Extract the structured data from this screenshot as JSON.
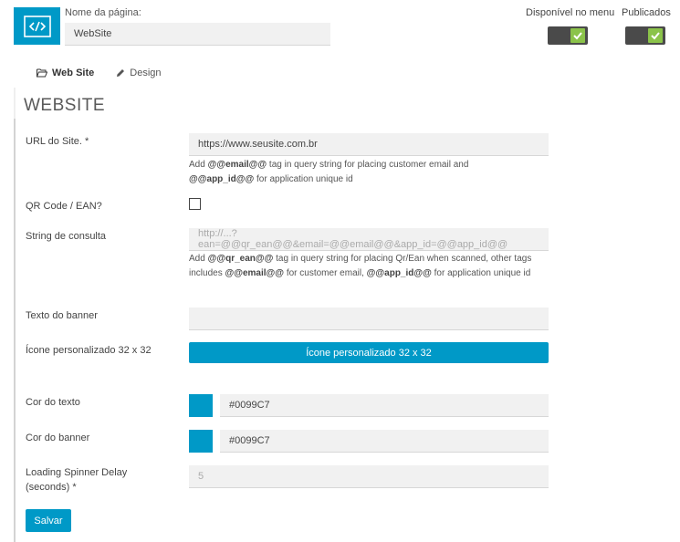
{
  "header": {
    "icon": "code-icon",
    "page_name_label": "Nome da página:",
    "page_name_value": "WebSite",
    "toggles": [
      {
        "label": "Disponível no menu",
        "checked": true
      },
      {
        "label": "Publicados",
        "checked": true
      }
    ]
  },
  "tabs": [
    {
      "label": "Web Site",
      "icon": "folder-open-icon",
      "active": true
    },
    {
      "label": "Design",
      "icon": "pencil-icon",
      "active": false
    }
  ],
  "panel": {
    "title": "WEBSITE",
    "url": {
      "label": "URL do Site. *",
      "value": "https://www.seusite.com.br",
      "help": {
        "p1": "Add ",
        "b1": "@@email@@",
        "p2": " tag in query string for placing customer email and ",
        "b2": "@@app_id@@",
        "p3": " for application unique id"
      }
    },
    "qr": {
      "label": "QR Code / EAN?",
      "checked": false
    },
    "query_string": {
      "label": "String de consulta",
      "placeholder": "http://...?ean=@@qr_ean@@&email=@@email@@&app_id=@@app_id@@",
      "help": {
        "p1": "Add ",
        "b1": "@@qr_ean@@",
        "p2": " tag in query string for placing Qr/Ean when scanned, other tags includes ",
        "b2": "@@email@@",
        "p3": " for customer email, ",
        "b3": "@@app_id@@",
        "p4": " for application unique id"
      }
    },
    "banner_text": {
      "label": "Texto do banner",
      "value": ""
    },
    "custom_icon": {
      "label": "Ícone personalizado 32 x 32",
      "button": "Ícone personalizado 32 x 32"
    },
    "text_color": {
      "label": "Cor do texto",
      "value": "#0099C7",
      "swatch": "#0099c7"
    },
    "banner_color": {
      "label": "Cor do banner",
      "value": "#0099C7",
      "swatch": "#0099c7"
    },
    "spinner_delay": {
      "label_line1": "Loading Spinner Delay",
      "label_line2": "(seconds) *",
      "placeholder": "5"
    },
    "save_label": "Salvar"
  },
  "colors": {
    "accent": "#0099c7",
    "toggle_on": "#8bc34a",
    "toggle_track": "#4a4a4a"
  }
}
